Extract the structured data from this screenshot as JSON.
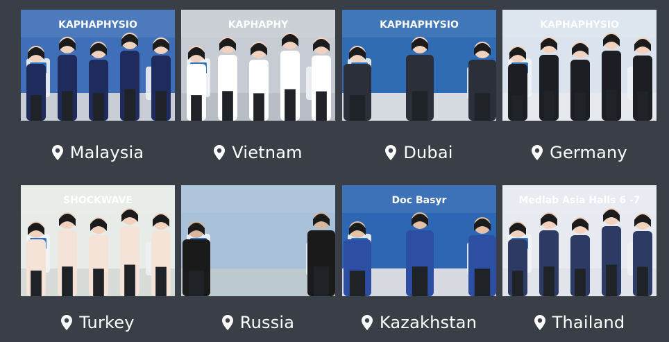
{
  "cards": [
    {
      "country": "Malaysia",
      "sign": "KAPHAPHYSIO",
      "wall": "#3e6fb8",
      "floor": "#c9ced6",
      "shirt": "#1f2b5c",
      "skin": "#f1d2bf"
    },
    {
      "country": "Vietnam",
      "sign": "KAPHAPHY",
      "wall": "#c7ccd4",
      "floor": "#b9bec6",
      "shirt": "#ffffff",
      "skin": "#f1d2bf"
    },
    {
      "country": "Dubai",
      "sign": "KAPHAPHYSIO",
      "wall": "#2f6cb3",
      "floor": "#d6dbe2",
      "shirt": "#2b2f3a",
      "skin": "#f1d2bf"
    },
    {
      "country": "Germany",
      "sign": "KAPHAPHYSIO",
      "wall": "#dbe3ee",
      "floor": "#e6e9ee",
      "shirt": "#1c1e24",
      "skin": "#f1d2bf"
    },
    {
      "country": "Turkey",
      "sign": "SHOCKWAVE",
      "wall": "#e8ece8",
      "floor": "#d8dcd8",
      "shirt": "#f4e3d6",
      "skin": "#f1d2bf"
    },
    {
      "country": "Russia",
      "sign": "",
      "wall": "#a9c1d8",
      "floor": "#bcc9cf",
      "shirt": "#1a1a1a",
      "skin": "#d9b59c"
    },
    {
      "country": "Kazakhstan",
      "sign": "Doc Basyr",
      "wall": "#2d67b3",
      "floor": "#d7dbe1",
      "shirt": "#2c4fa3",
      "skin": "#e4c0a6"
    },
    {
      "country": "Thailand",
      "sign": "Medlab Asia Halls 6 -7",
      "wall": "#e7eaf0",
      "floor": "#e1e4ea",
      "shirt": "#2d3a63",
      "skin": "#f1d2bf"
    }
  ]
}
